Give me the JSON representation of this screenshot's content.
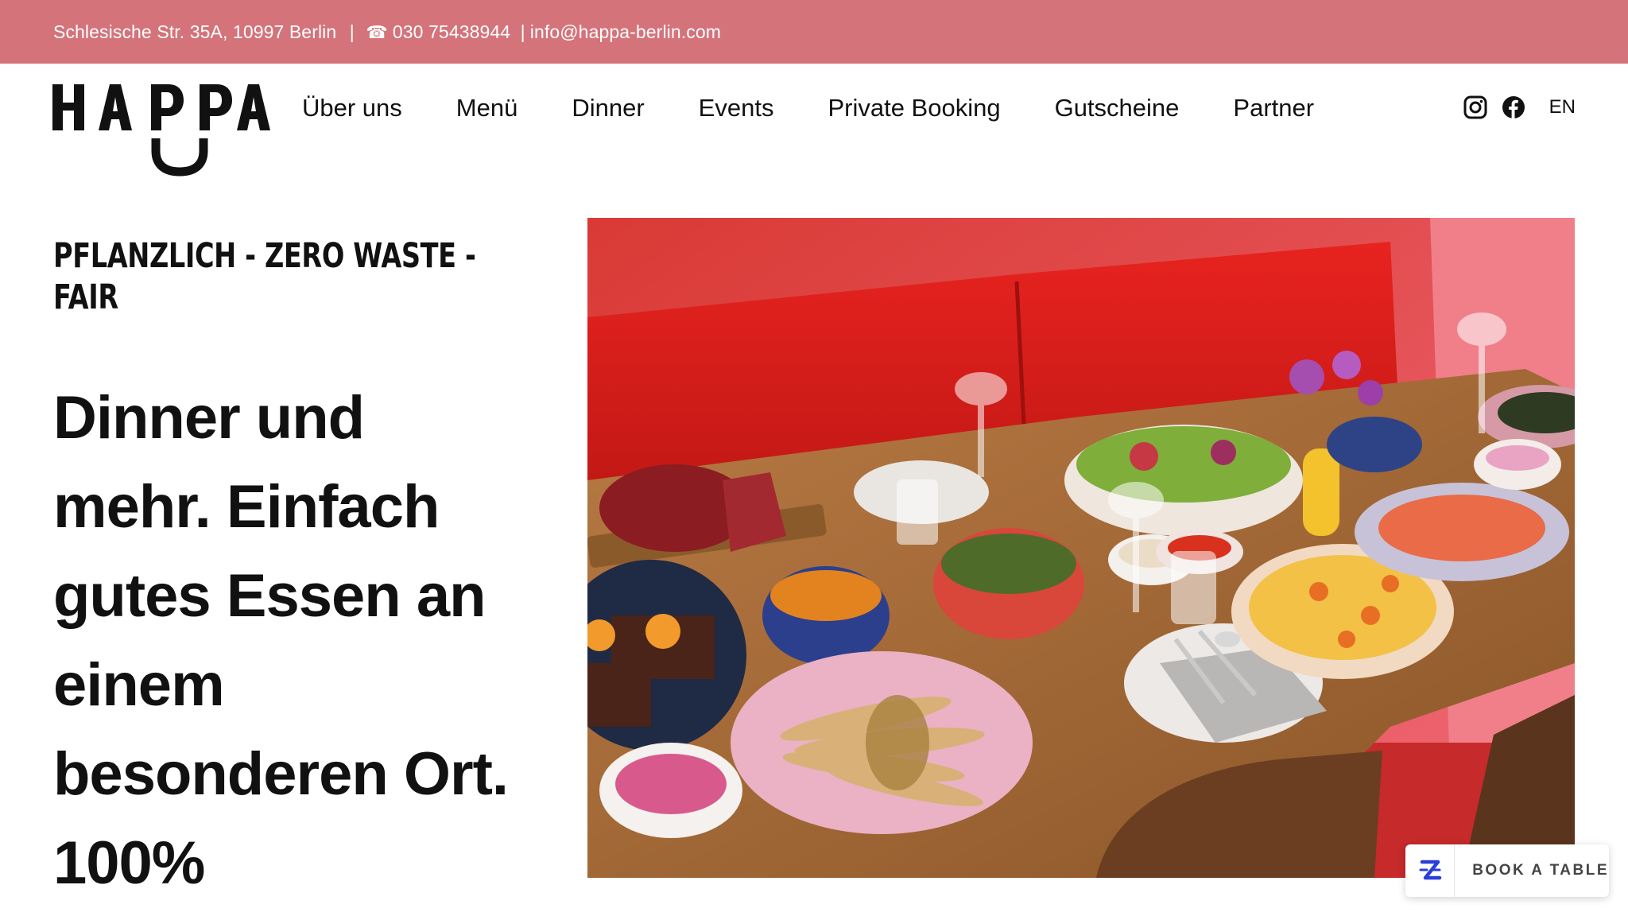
{
  "topbar": {
    "address": "Schlesische Str. 35A, 10997 Berlin",
    "separator": "|",
    "phone_icon": "☎",
    "phone": "030 75438944",
    "separator2": "|",
    "email": "info@happa-berlin.com",
    "background_color": "#d4737a"
  },
  "header": {
    "logo_text": "HAPPA",
    "nav": [
      {
        "label": "Über uns"
      },
      {
        "label": "Menü"
      },
      {
        "label": "Dinner"
      },
      {
        "label": "Events"
      },
      {
        "label": "Private Booking"
      },
      {
        "label": "Gutscheine"
      },
      {
        "label": "Partner"
      }
    ],
    "social": {
      "instagram_icon": "instagram-icon",
      "facebook_icon": "facebook-icon",
      "language": "EN"
    }
  },
  "hero": {
    "kicker": "PFLANZLICH - ZERO WASTE - FAIR",
    "headline": "Dinner und mehr. Einfach gutes Essen an einem besonderen Ort. 100%",
    "image_description_icon": "food-table-photo"
  },
  "booking_widget": {
    "label": "BOOK A TABLE",
    "icon": "zenchef-z-icon"
  }
}
